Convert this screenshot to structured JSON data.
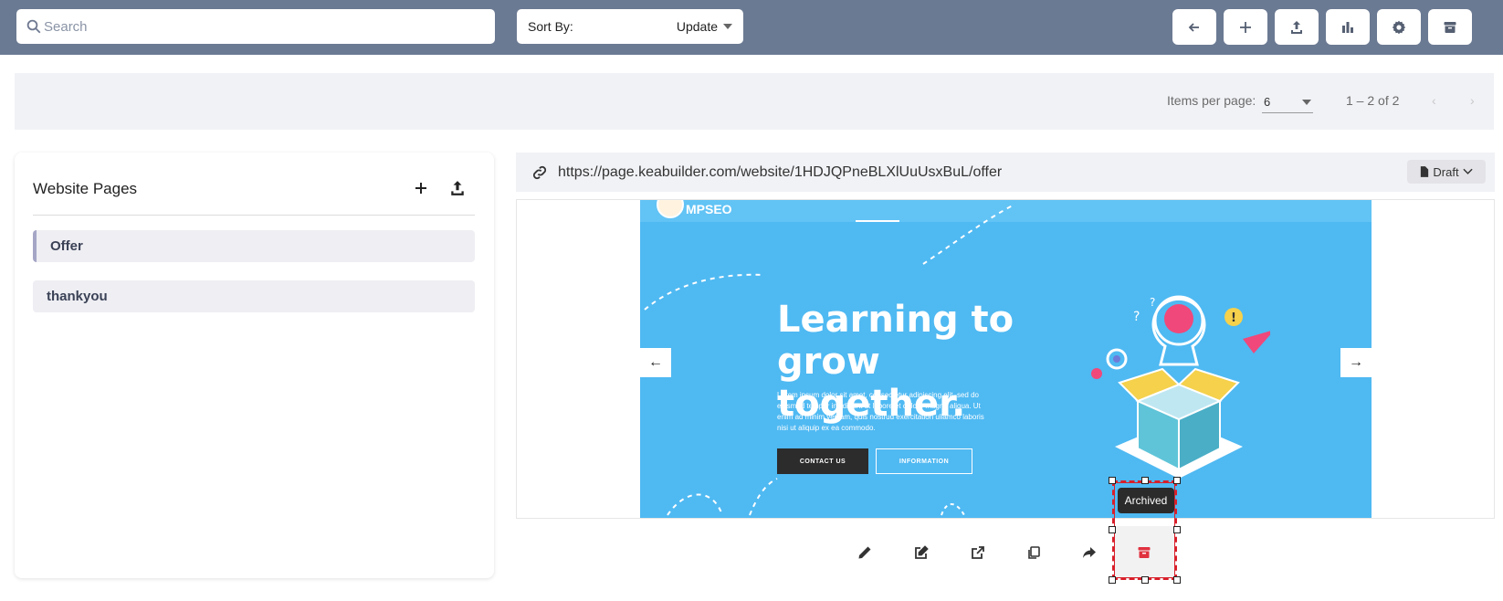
{
  "header": {
    "search_placeholder": "Search",
    "sort": {
      "label": "Sort By:",
      "value": "Update"
    },
    "toolbar_icons": [
      "back-arrow-icon",
      "plus-icon",
      "upload-icon",
      "bar-chart-icon",
      "gear-icon",
      "archive-icon"
    ]
  },
  "pagination": {
    "items_per_page_label": "Items per page:",
    "items_per_page_value": "6",
    "range": "1 – 2 of 2",
    "prev": "‹",
    "next": "›"
  },
  "left_panel": {
    "title": "Website Pages",
    "pages": [
      {
        "label": "Offer",
        "active": true
      },
      {
        "label": "thankyou",
        "active": false
      }
    ]
  },
  "url_bar": {
    "url": "https://page.keabuilder.com/website/1HDJQPneBLXlUuUsxBuL/offer",
    "status": "Draft"
  },
  "preview": {
    "logo_text": "MPSEO",
    "headline": "Learning to grow together.",
    "body": "Lorem ipsum dolor sit amet, consectetur adipiscing elit, sed do eiusmod tempor incididunt ut labore et dolore magna aliqua. Ut enim ad minim veniam, quis nostrud exercitation ullamco laboris nisi ut aliquip ex ea commodo.",
    "primary_button": "CONTACT US",
    "secondary_button": "INFORMATION",
    "prev_arrow": "←",
    "next_arrow": "→"
  },
  "actions": {
    "icons": [
      "pencil-icon",
      "edit-square-icon",
      "external-link-icon",
      "copy-icon",
      "share-icon",
      "archive-icon"
    ],
    "tooltip": "Archived"
  },
  "colors": {
    "topbar": "#6b7a93",
    "slide_bg": "#4fb9f2",
    "archive_icon": "#e0313f",
    "selection": "#d81f2a"
  }
}
